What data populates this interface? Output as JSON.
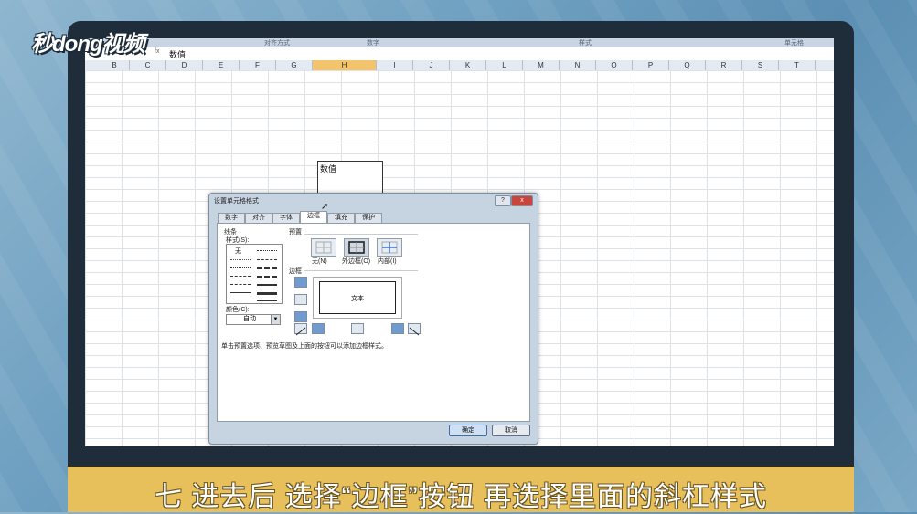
{
  "watermark": {
    "logo_text": "秒dong视频"
  },
  "spreadsheet": {
    "ribbon_labels": [
      "对齐方式",
      "数字",
      "样式",
      "单元格"
    ],
    "formula_bar": {
      "fx": "fx",
      "value": "数值"
    },
    "columns": [
      "B",
      "C",
      "D",
      "E",
      "F",
      "G",
      "H",
      "I",
      "J",
      "K",
      "L",
      "M",
      "N",
      "O",
      "P",
      "Q",
      "R",
      "S",
      "T"
    ],
    "selected_column": "H",
    "cell_text": "数值"
  },
  "dialog": {
    "title": "设置单元格格式",
    "help_label": "?",
    "close_label": "x",
    "tabs": [
      "数字",
      "对齐",
      "字体",
      "边框",
      "填充",
      "保护"
    ],
    "active_tab": "边框",
    "line_group": "线条",
    "style_label": "样式(S):",
    "style_none": "无",
    "color_label": "颜色(C):",
    "color_value": "自动",
    "preset_group": "预置",
    "presets": [
      "无(N)",
      "外边框(O)",
      "内部(I)"
    ],
    "border_group": "边框",
    "preview_text": "文本",
    "hint": "单击预置选项、预览草图及上面的按钮可以添加边框样式。",
    "ok_label": "确定",
    "cancel_label": "取消"
  },
  "caption": "七  进去后  选择“边框”按钮  再选择里面的斜杠样式"
}
